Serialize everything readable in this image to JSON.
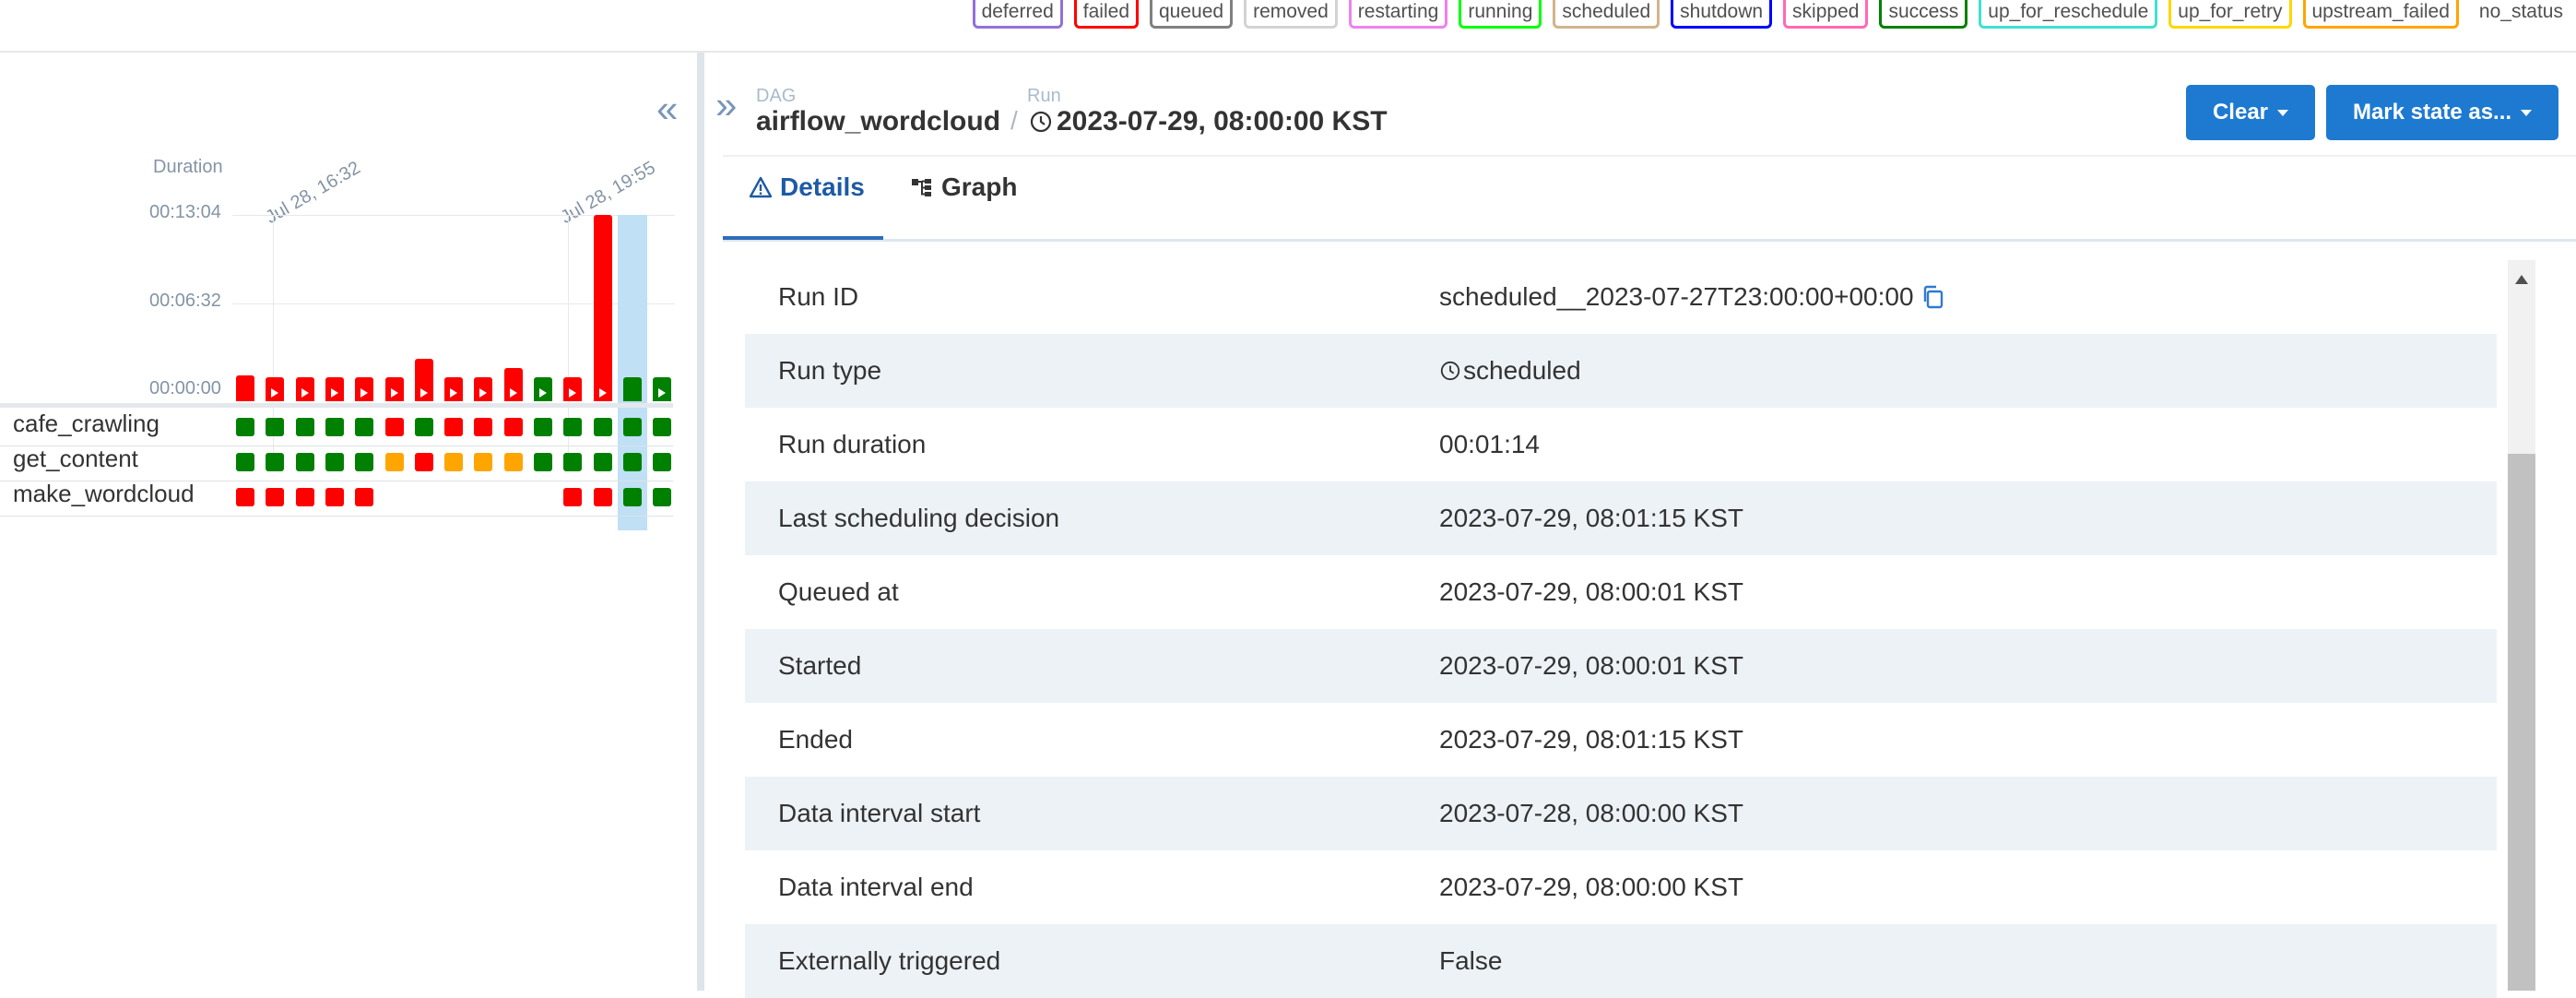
{
  "legend": [
    {
      "label": "deferred",
      "color": "#9370db"
    },
    {
      "label": "failed",
      "color": "#ff0000"
    },
    {
      "label": "queued",
      "color": "#808080"
    },
    {
      "label": "removed",
      "color": "#d3d3d3"
    },
    {
      "label": "restarting",
      "color": "#ee82ee"
    },
    {
      "label": "running",
      "color": "#00ff00"
    },
    {
      "label": "scheduled",
      "color": "#d2b48c"
    },
    {
      "label": "shutdown",
      "color": "#0000ff"
    },
    {
      "label": "skipped",
      "color": "#ff69b4"
    },
    {
      "label": "success",
      "color": "#008000"
    },
    {
      "label": "up_for_reschedule",
      "color": "#40e0d0"
    },
    {
      "label": "up_for_retry",
      "color": "#ffd700"
    },
    {
      "label": "upstream_failed",
      "color": "#ffa500"
    },
    {
      "label": "no_status",
      "color": ""
    }
  ],
  "grid": {
    "duration_title": "Duration",
    "date_ticks": [
      "Jul 28, 16:32",
      "Jul 28, 19:55"
    ],
    "y_labels": [
      "00:13:04",
      "00:06:32",
      "00:00:00"
    ],
    "runs": [
      {
        "state": "failed",
        "duration": 0.14
      },
      {
        "state": "failed",
        "duration": 0.13
      },
      {
        "state": "failed",
        "duration": 0.13
      },
      {
        "state": "failed",
        "duration": 0.13
      },
      {
        "state": "failed",
        "duration": 0.13
      },
      {
        "state": "failed",
        "duration": 0.13
      },
      {
        "state": "failed",
        "duration": 0.23
      },
      {
        "state": "failed",
        "duration": 0.13
      },
      {
        "state": "failed",
        "duration": 0.13
      },
      {
        "state": "failed",
        "duration": 0.18
      },
      {
        "state": "success",
        "duration": 0.13
      },
      {
        "state": "failed",
        "duration": 0.13
      },
      {
        "state": "failed",
        "duration": 1.0
      },
      {
        "state": "success",
        "duration": 0.13,
        "selected": true
      },
      {
        "state": "success",
        "duration": 0.13
      }
    ],
    "tasks": [
      {
        "name": "cafe_crawling",
        "states": [
          "success",
          "success",
          "success",
          "success",
          "success",
          "failed",
          "success",
          "failed",
          "failed",
          "failed",
          "success",
          "success",
          "success",
          "success",
          "success"
        ]
      },
      {
        "name": "get_content",
        "states": [
          "success",
          "success",
          "success",
          "success",
          "success",
          "upstream_failed",
          "failed",
          "upstream_failed",
          "upstream_failed",
          "upstream_failed",
          "success",
          "success",
          "success",
          "success",
          "success"
        ]
      },
      {
        "name": "make_wordcloud",
        "states": [
          "failed",
          "failed",
          "failed",
          "failed",
          "failed",
          "",
          "",
          "",
          "",
          "",
          "",
          "failed",
          "failed",
          "success",
          "success"
        ]
      }
    ]
  },
  "breadcrumb": {
    "dag_caption": "DAG",
    "dag_name": "airflow_wordcloud",
    "run_caption": "Run",
    "run_name": "2023-07-29, 08:00:00 KST"
  },
  "buttons": {
    "clear": "Clear",
    "mark_state": "Mark state as..."
  },
  "tabs": [
    {
      "label": "Details",
      "active": true
    },
    {
      "label": "Graph",
      "active": false
    }
  ],
  "details": [
    {
      "key": "Run ID",
      "value": "scheduled__2023-07-27T23:00:00+00:00"
    },
    {
      "key": "Run type",
      "value": "scheduled"
    },
    {
      "key": "Run duration",
      "value": "00:01:14"
    },
    {
      "key": "Last scheduling decision",
      "value": "2023-07-29, 08:01:15 KST"
    },
    {
      "key": "Queued at",
      "value": "2023-07-29, 08:00:01 KST"
    },
    {
      "key": "Started",
      "value": "2023-07-29, 08:00:01 KST"
    },
    {
      "key": "Ended",
      "value": "2023-07-29, 08:01:15 KST"
    },
    {
      "key": "Data interval start",
      "value": "2023-07-28, 08:00:00 KST"
    },
    {
      "key": "Data interval end",
      "value": "2023-07-29, 08:00:00 KST"
    },
    {
      "key": "Externally triggered",
      "value": "False"
    }
  ]
}
